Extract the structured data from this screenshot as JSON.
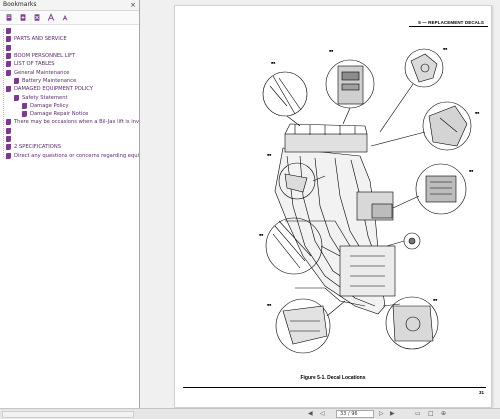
{
  "panel": {
    "title": "Bookmarks",
    "close_glyph": "×"
  },
  "toolbar": {
    "icons": [
      "bookmark-expand-icon",
      "bookmark-new-icon",
      "bookmark-delete-icon",
      "text-increase-icon",
      "text-decrease-icon"
    ]
  },
  "bookmarks": [
    {
      "label": "",
      "level": 0
    },
    {
      "label": "PARTS AND SERVICE",
      "level": 0
    },
    {
      "label": "",
      "level": 0
    },
    {
      "label": "BOOM PERSONNEL LIFT",
      "level": 0
    },
    {
      "label": "LIST OF TABLES",
      "level": 0
    },
    {
      "label": "General Maintenance",
      "level": 0
    },
    {
      "label": "Battery Maintenance",
      "level": 1
    },
    {
      "label": "DAMAGED EQUIPMENT POLICY",
      "level": 0
    },
    {
      "label": "Safety Statement",
      "level": 1
    },
    {
      "label": "Damage Policy",
      "level": 2
    },
    {
      "label": "Damage Repair Notice",
      "level": 2
    },
    {
      "label": "There may be occasions when a Bil-Jax lift is involv",
      "level": 0
    },
    {
      "label": "",
      "level": 0
    },
    {
      "label": "",
      "level": 0
    },
    {
      "label": "2 SPECIFICATIONS",
      "level": 0
    },
    {
      "label": "Direct any questions or concerns regarding equip",
      "level": 0
    }
  ],
  "document": {
    "running_header": "5 — REPLACEMENT DECALS",
    "figure_caption": "Figure 5-1.  Decal Locations",
    "page_number": "31"
  },
  "status": {
    "page_indicator": "33 / 96"
  },
  "colors": {
    "bookmark_icon": "#7a3d8c",
    "bookmark_text": "#5a2a6a"
  }
}
